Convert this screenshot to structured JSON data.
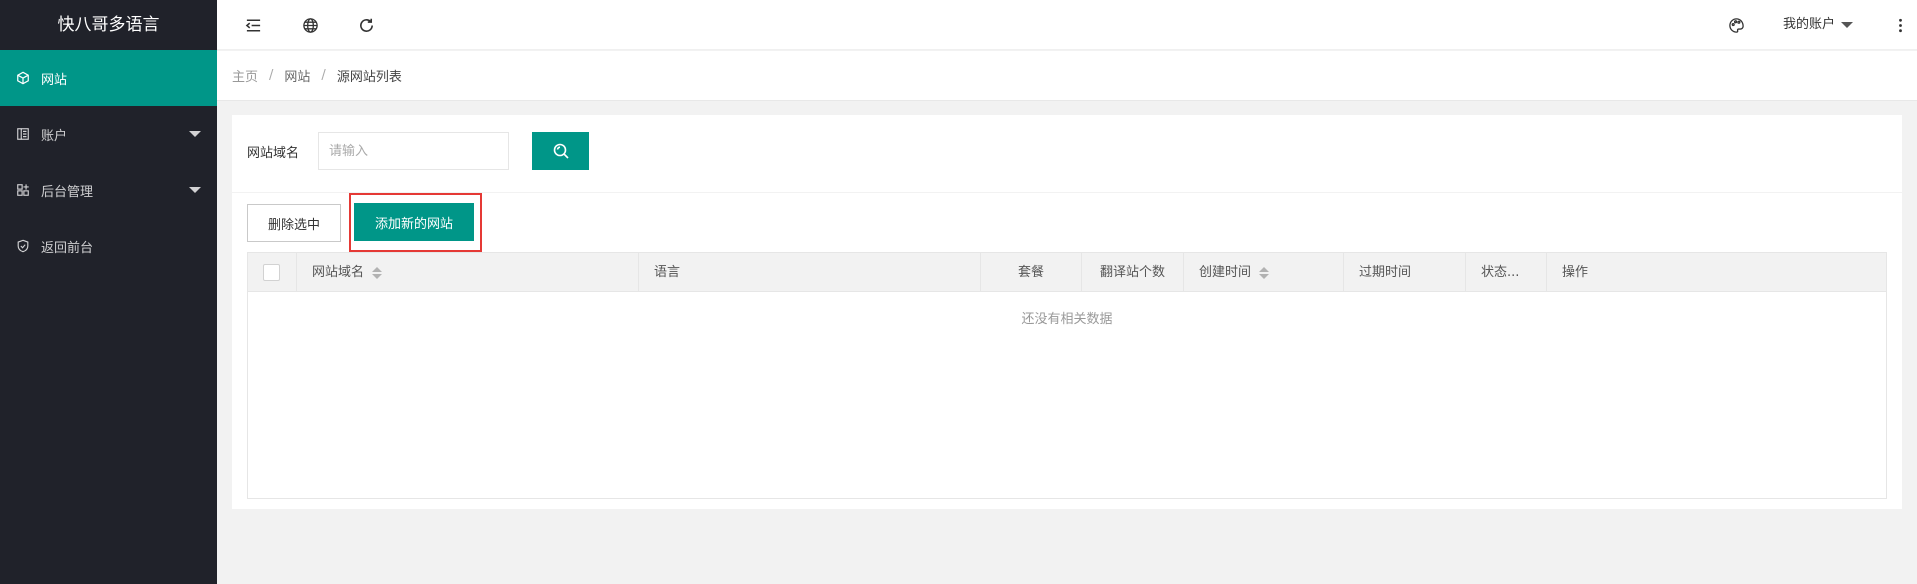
{
  "app": {
    "title": "快八哥多语言"
  },
  "sidebar": {
    "items": [
      {
        "label": "网站",
        "icon": "cube-icon",
        "active": true
      },
      {
        "label": "账户",
        "icon": "book-icon",
        "expandable": true
      },
      {
        "label": "后台管理",
        "icon": "apps-icon",
        "expandable": true
      },
      {
        "label": "返回前台",
        "icon": "shield-icon"
      }
    ]
  },
  "header": {
    "icons": [
      "menu-fold-icon",
      "globe-icon",
      "refresh-icon",
      "palette-icon",
      "more-vertical-icon"
    ],
    "account_label": "我的账户"
  },
  "breadcrumb": {
    "items": [
      "主页",
      "网站",
      "源网站列表"
    ],
    "separator": "/"
  },
  "search": {
    "label": "网站域名",
    "value": "",
    "placeholder": "请输入"
  },
  "toolbar": {
    "delete_label": "删除选中",
    "add_label": "添加新的网站"
  },
  "table": {
    "columns": [
      "网站域名",
      "语言",
      "套餐",
      "翻译站个数",
      "创建时间",
      "过期时间",
      "状态...",
      "操作"
    ],
    "empty_text": "还没有相关数据"
  },
  "colors": {
    "accent": "#009688",
    "sidebar_bg": "#20222a",
    "highlight_border": "#e53935"
  }
}
